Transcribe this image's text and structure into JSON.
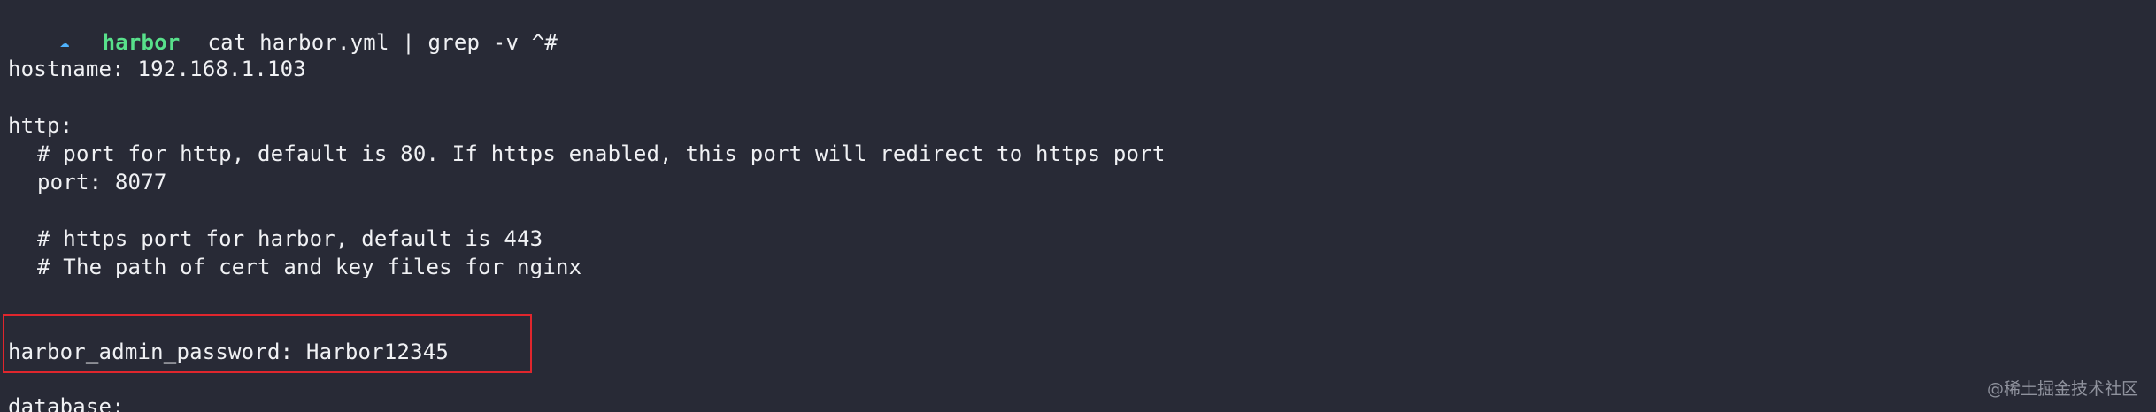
{
  "terminal": {
    "prompt": {
      "icon": "prompt-arrow-icon",
      "directory": "harbor",
      "command": "cat harbor.yml | grep -v ^#"
    },
    "lines": {
      "hostname": "hostname: 192.168.1.103",
      "http": "http:",
      "http_comment": "# port for http, default is 80. If https enabled, this port will redirect to https port",
      "port": "port: 8077",
      "https_comment": "# https port for harbor, default is 443",
      "cert_comment": "# The path of cert and key files for nginx",
      "admin_password": "harbor_admin_password: Harbor12345",
      "database": "database:"
    },
    "watermark": "@稀土掘金技术社区",
    "colors": {
      "background": "#282a36",
      "text": "#f0f1f4",
      "prompt_directory": "#58e08b",
      "prompt_icon": "#4fb3ff",
      "highlight_border": "#e0262d"
    }
  }
}
